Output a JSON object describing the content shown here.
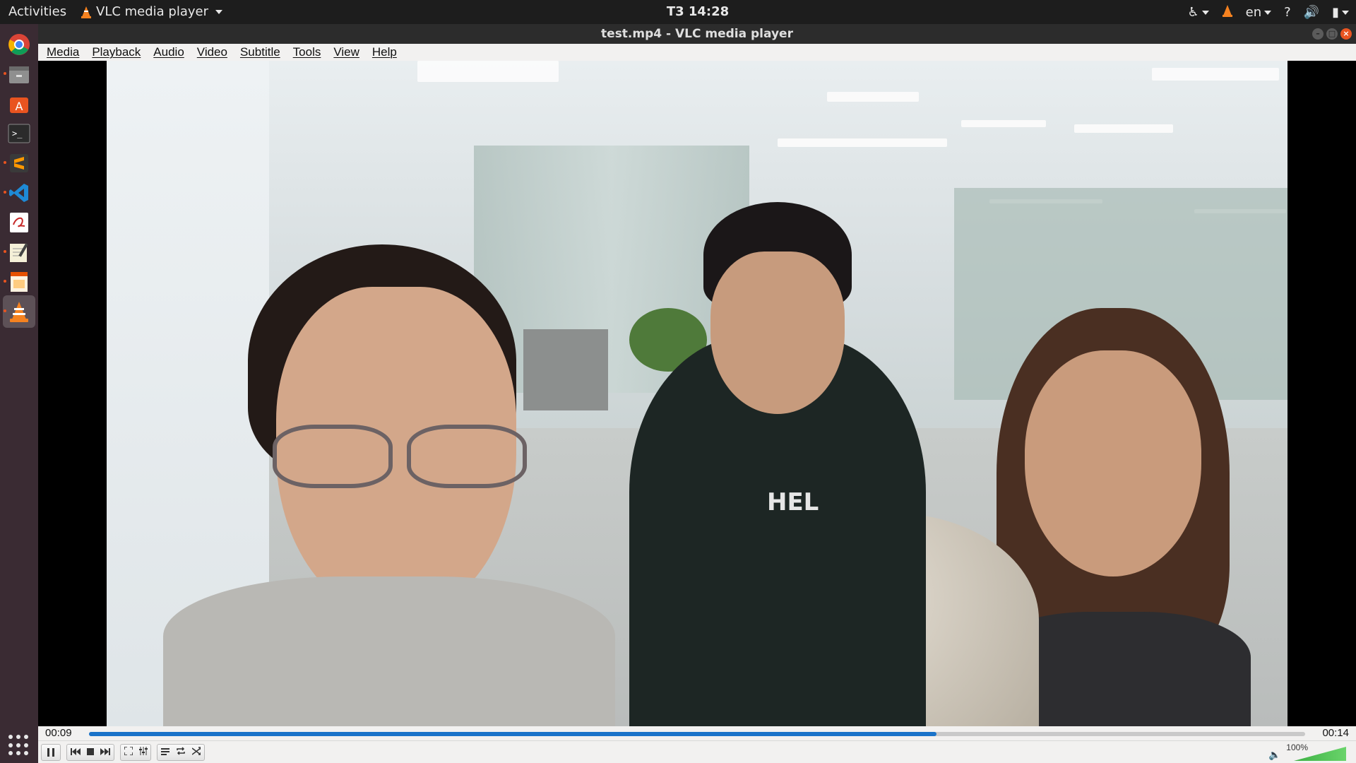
{
  "topbar": {
    "activities": "Activities",
    "app_name": "VLC media player",
    "clock": "T3 14:28",
    "language": "en"
  },
  "dock": {
    "items": [
      "Chrome",
      "Files",
      "Ubuntu Software",
      "Terminal",
      "Sublime Text",
      "Visual Studio Code",
      "Evince",
      "Text Editor",
      "Document Viewer",
      "VLC media player"
    ],
    "active": "VLC media player"
  },
  "window": {
    "title": "test.mp4 - VLC media player"
  },
  "menubar": {
    "items": [
      "Media",
      "Playback",
      "Audio",
      "Video",
      "Subtitle",
      "Tools",
      "View",
      "Help"
    ]
  },
  "video": {
    "shirt_text": "HEL"
  },
  "playback": {
    "current_time": "00:09",
    "total_time": "00:14",
    "progress_fraction": 0.697,
    "volume_label": "100%",
    "volume_fraction": 1.0
  },
  "colors": {
    "accent": "#e95420",
    "seek_fill": "#1a73c9",
    "volume": "#3cb043"
  }
}
